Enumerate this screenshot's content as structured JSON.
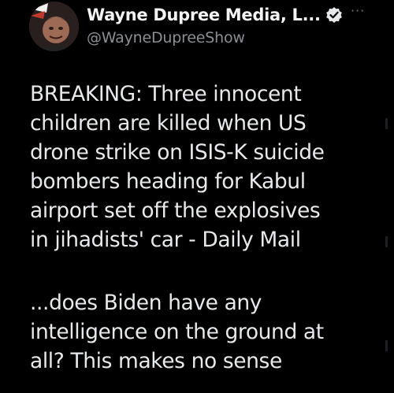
{
  "author": {
    "display_name": "Wayne Dupree Media, L...",
    "handle": "@WayneDupreeShow",
    "verified_icon": "verified-badge-icon",
    "avatar_icon": "avatar-icon"
  },
  "more_menu": {
    "label": "···",
    "icon": "more-options-icon"
  },
  "tweet": {
    "paragraph_1": [
      "BREAKING: Three innocent",
      "children are killed when US",
      "drone strike on ISIS-K suicide",
      "bombers heading for Kabul",
      "airport set off the explosives",
      "in jihadists' car - Daily Mail"
    ],
    "paragraph_2": [
      "...does Biden have any",
      "intelligence on the ground at",
      "all? This makes no sense"
    ]
  },
  "colors": {
    "background": "#000000",
    "text": "#e7e9ea",
    "secondary_text": "#8b8f94",
    "verified_badge": "#e7e9ea"
  }
}
